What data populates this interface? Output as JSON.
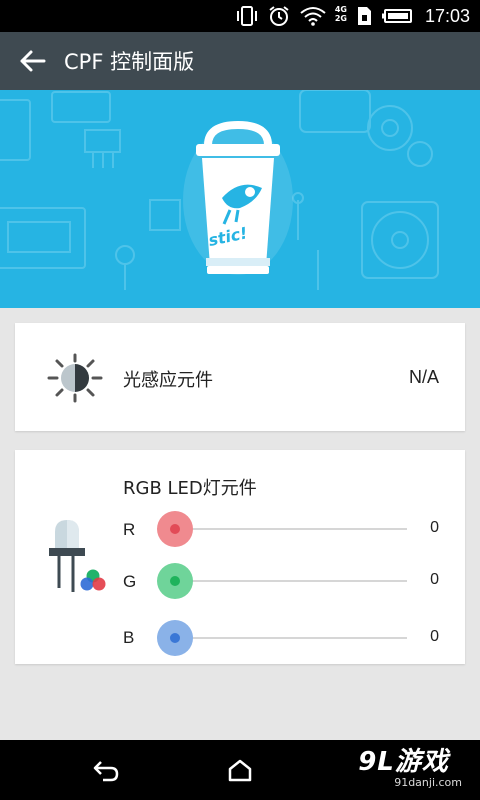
{
  "status_bar": {
    "network_top": "4G",
    "network_bottom": "2G",
    "time": "17:03"
  },
  "app_bar": {
    "title": "CPF 控制面版",
    "back_icon": "arrow-left-icon"
  },
  "banner": {
    "illustration": "cup-mascot-illustration"
  },
  "light_sensor": {
    "label": "光感应元件",
    "value": "N/A",
    "icon": "light-sensor-icon"
  },
  "rgb_led": {
    "title": "RGB LED灯元件",
    "icon": "led-icon",
    "channels": [
      {
        "label": "R",
        "value": "0",
        "level": 0,
        "color": "#f08a8f",
        "dot_color": "#e24b57"
      },
      {
        "label": "G",
        "value": "0",
        "level": 0,
        "color": "#6fd49a",
        "dot_color": "#1fb35c"
      },
      {
        "label": "B",
        "value": "0",
        "level": 0,
        "color": "#8ab2e8",
        "dot_color": "#3a77d6"
      }
    ]
  },
  "nav_bar": {
    "back_icon": "nav-back-icon",
    "home_icon": "home-icon"
  },
  "watermark": {
    "brand": "9L游戏",
    "domain": "91danji.com"
  },
  "colors": {
    "app_bar": "#3f4a51",
    "banner": "#26b4e3",
    "background": "#e6e6e6"
  }
}
